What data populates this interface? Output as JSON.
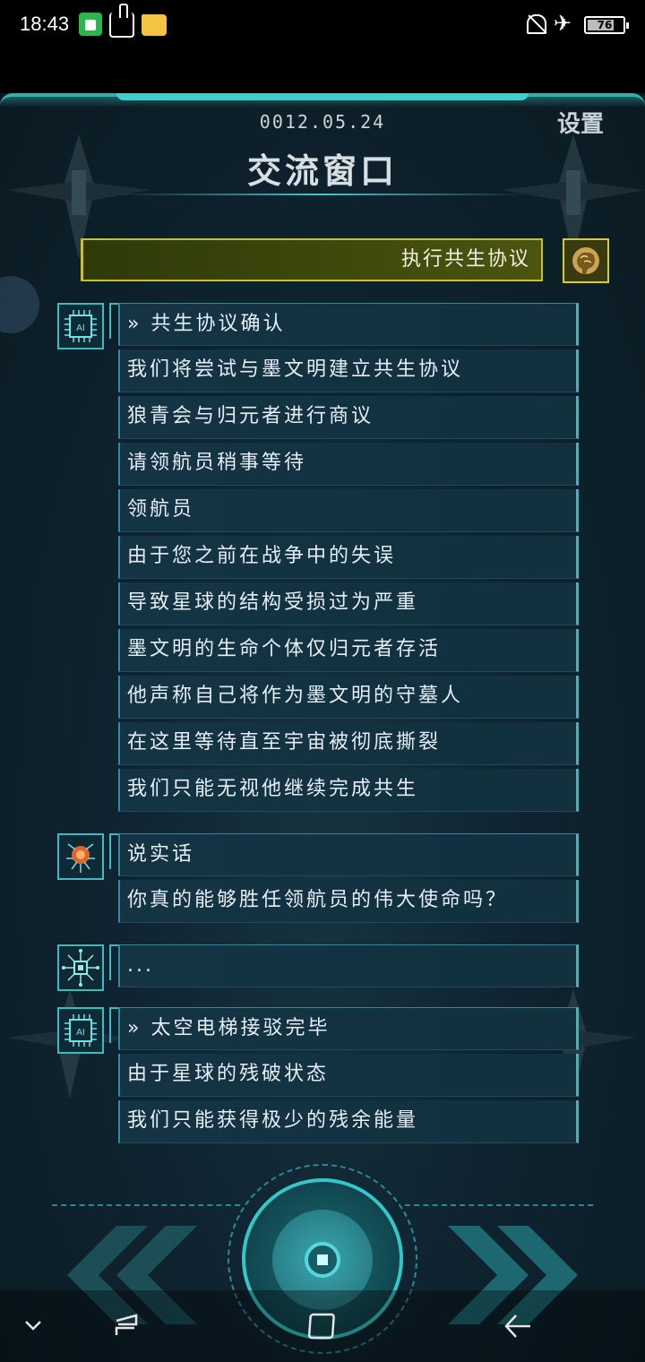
{
  "status_bar": {
    "time": "18:43",
    "battery": "76",
    "battery_fraction": 0.76,
    "icons": [
      "app-notification-icon",
      "touch-icon",
      "folder-icon",
      "mute-icon",
      "airplane-icon",
      "battery-icon"
    ]
  },
  "header": {
    "date": "0012.05.24",
    "settings_label": "设置",
    "title": "交流窗口"
  },
  "player_message": {
    "text": "执行共生协议",
    "avatar_icon": "brain-icon"
  },
  "conversation": [
    {
      "avatar_icon": "ai-chip-icon",
      "lines": [
        "» 共生协议确认",
        "我们将尝试与墨文明建立共生协议",
        "狼青会与归元者进行商议",
        "请领航员稍事等待",
        "领航员",
        "由于您之前在战争中的失误",
        "导致星球的结构受损过为严重",
        "墨文明的生命个体仅归元者存活",
        "他声称自己将作为墨文明的守墓人",
        "在这里等待直至宇宙被彻底撕裂",
        "我们只能无视他继续完成共生"
      ]
    },
    {
      "avatar_icon": "red-core-icon",
      "lines": [
        "说实话",
        "你真的能够胜任领航员的伟大使命吗？"
      ]
    },
    {
      "avatar_icon": "circuit-chip-icon",
      "lines": [
        "..."
      ]
    },
    {
      "avatar_icon": "ai-chip-icon",
      "lines": [
        "» 太空电梯接驳完毕",
        "由于星球的残破状态",
        "我们只能获得极少的残余能量"
      ]
    }
  ],
  "colors": {
    "accent": "#3fbac4",
    "player_border": "#d8cc32",
    "background": "#0f2430"
  },
  "nav": {
    "icons": [
      "chevron-down-icon",
      "recent-apps-icon",
      "home-icon",
      "back-icon"
    ]
  }
}
